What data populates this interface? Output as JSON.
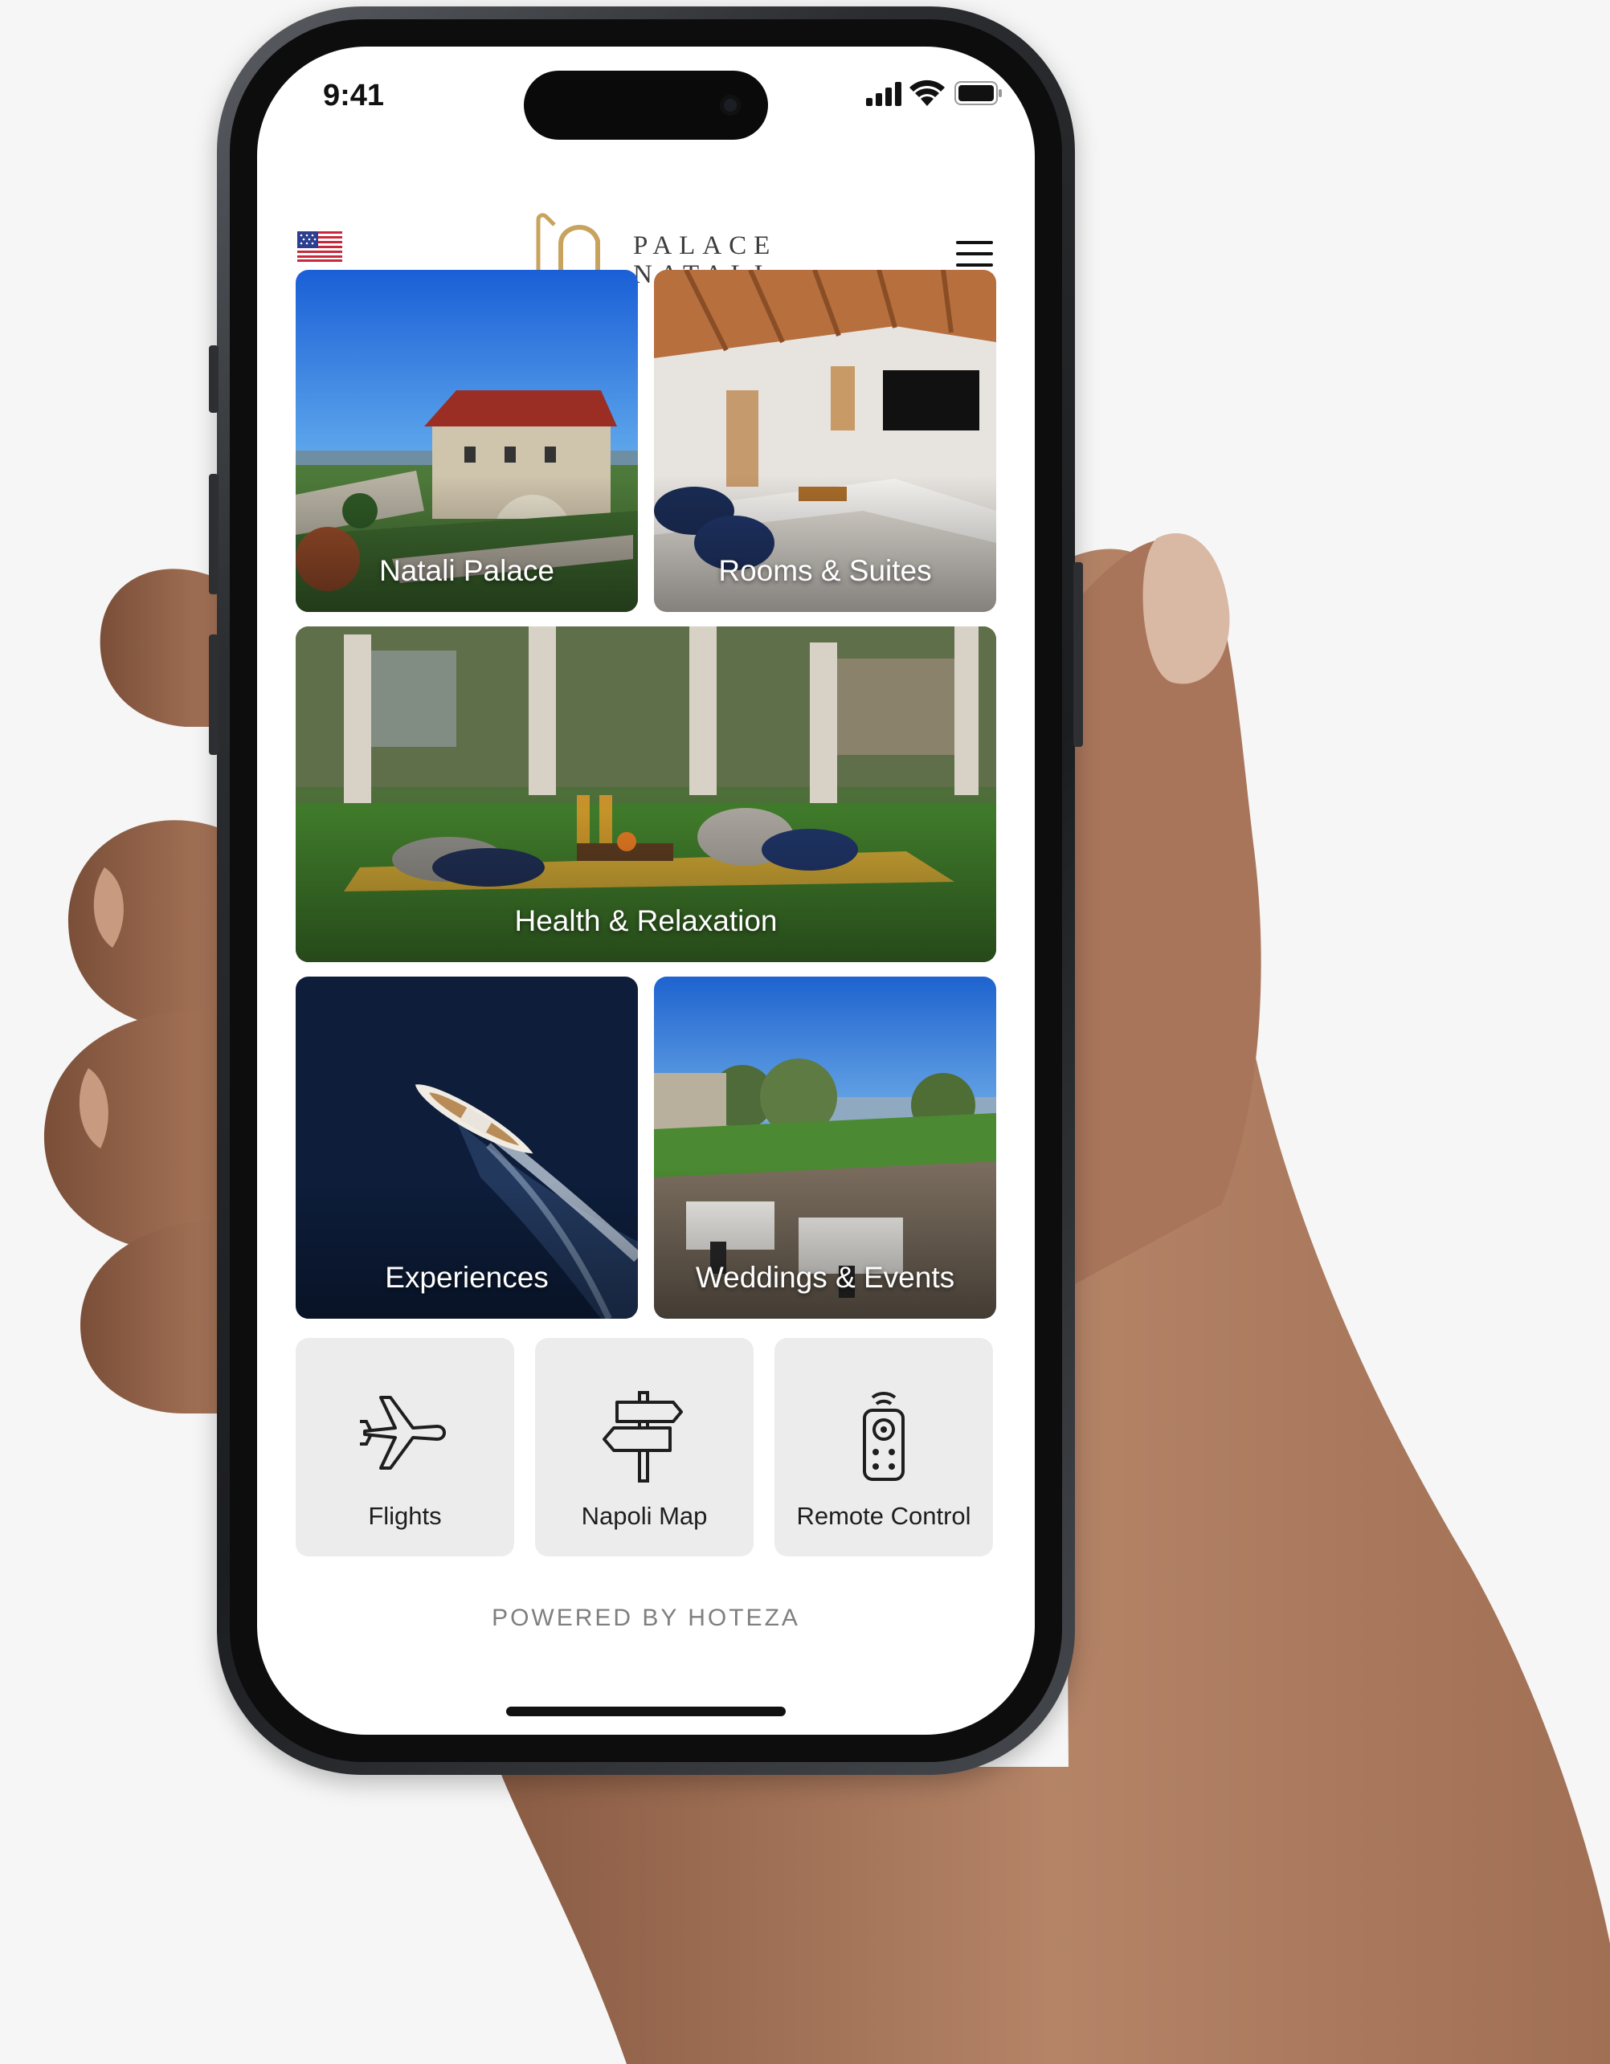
{
  "status_bar": {
    "time": "9:41"
  },
  "header": {
    "flag_icon": "us-flag-icon",
    "brand_line1": "PALACE",
    "brand_line2": "NATALI",
    "menu_icon": "hamburger-menu-icon"
  },
  "tiles": [
    {
      "label": "Natali Palace"
    },
    {
      "label": "Rooms & Suites"
    },
    {
      "label": "Health & Relaxation"
    },
    {
      "label": "Experiences"
    },
    {
      "label": "Weddings & Events"
    }
  ],
  "utilities": [
    {
      "label": "Flights",
      "icon": "airplane-icon"
    },
    {
      "label": "Napoli Map",
      "icon": "signpost-icon"
    },
    {
      "label": "Remote Control",
      "icon": "remote-control-icon"
    }
  ],
  "footer": {
    "powered_by": "POWERED BY HOTEZA"
  },
  "colors": {
    "accent_gold": "#c8a35e",
    "tile_utility_bg": "#ececec",
    "page_bg": "#f6f6f6"
  }
}
